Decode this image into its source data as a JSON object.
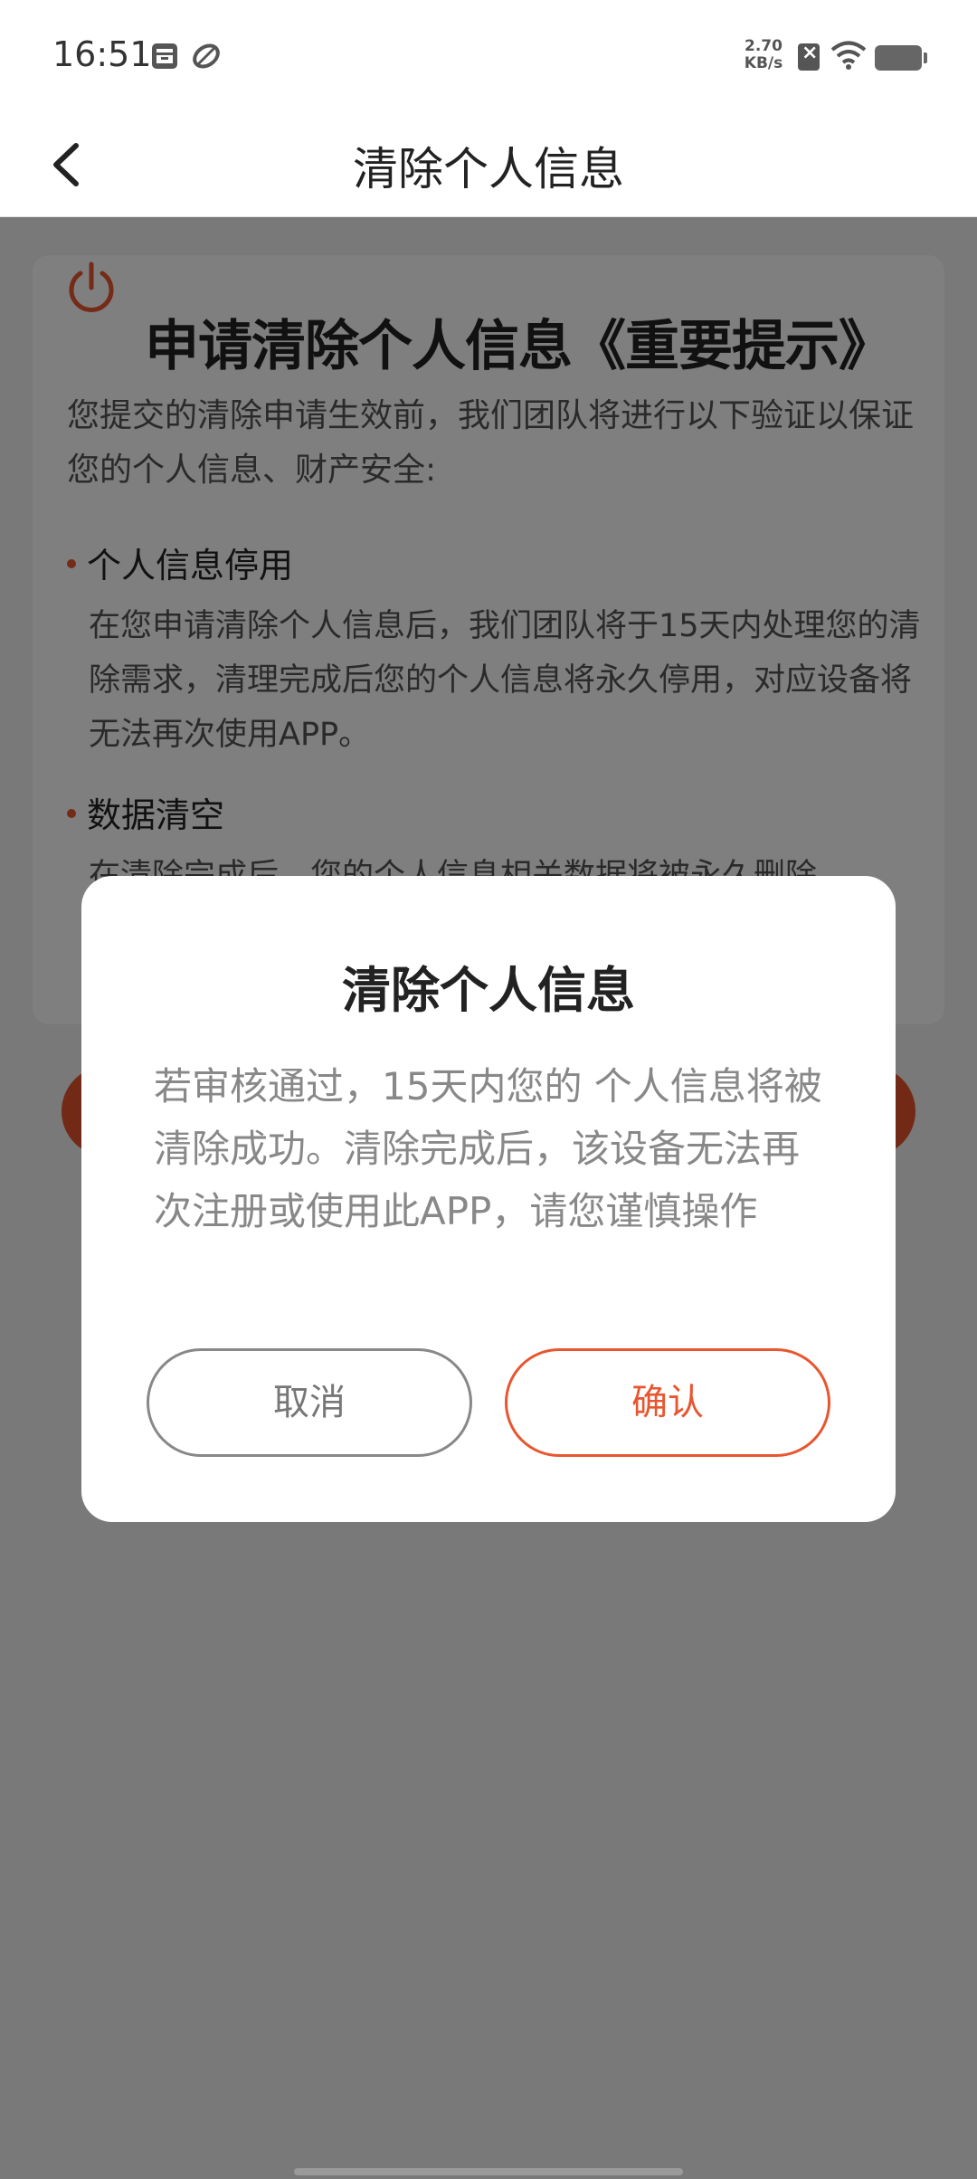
{
  "status_bar": {
    "time": "16:51",
    "net_speed_value": "2.70",
    "net_speed_unit": "KB/s",
    "icons": [
      "storage-icon",
      "leaf-icon",
      "sim-disabled-icon",
      "wifi-icon",
      "battery-icon"
    ]
  },
  "header": {
    "title": "清除个人信息",
    "back_icon": "chevron-left-icon"
  },
  "card": {
    "title": "申请清除个人信息《重要提示》",
    "intro": "您提交的清除申请生效前，我们团队将进行以下验证以保证您的个人信息、财产安全:",
    "sections": [
      {
        "title": "个人信息停用",
        "body": "在您申请清除个人信息后，我们团队将于15天内处理您的清除需求，清理完成后您的个人信息将永久停用，对应设备将无法再次使用APP。"
      },
      {
        "title": "数据清空",
        "body": "在清除完成后，您的个人信息相关数据将被永久删除。"
      }
    ]
  },
  "dialog": {
    "title": "清除个人信息",
    "message": "若审核通过，15天内您的 个人信息将被清除成功。清除完成后，该设备无法再次注册或使用此APP，请您谨慎操作",
    "cancel_label": "取消",
    "confirm_label": "确认"
  },
  "colors": {
    "accent": "#e8562f",
    "overlay": "rgba(0,0,0,0.5)"
  }
}
